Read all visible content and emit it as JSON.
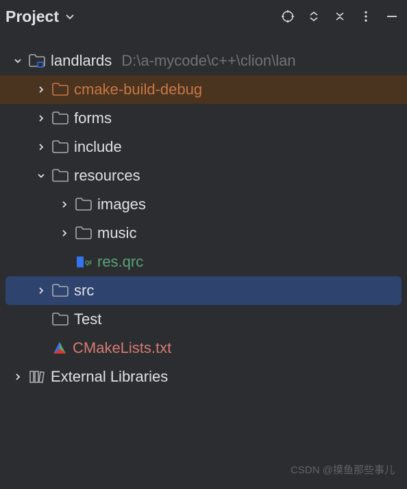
{
  "header": {
    "title": "Project"
  },
  "tree": {
    "root": {
      "name": "landlards",
      "path": "D:\\a-mycode\\c++\\clion\\lan"
    },
    "nodes": {
      "cmake_build": "cmake-build-debug",
      "forms": "forms",
      "include": "include",
      "resources": "resources",
      "images": "images",
      "music": "music",
      "res_qrc": "res.qrc",
      "src": "src",
      "test": "Test",
      "cmakelists": "CMakeLists.txt",
      "external": "External Libraries"
    }
  },
  "watermark": "CSDN @摸鱼那些事儿"
}
